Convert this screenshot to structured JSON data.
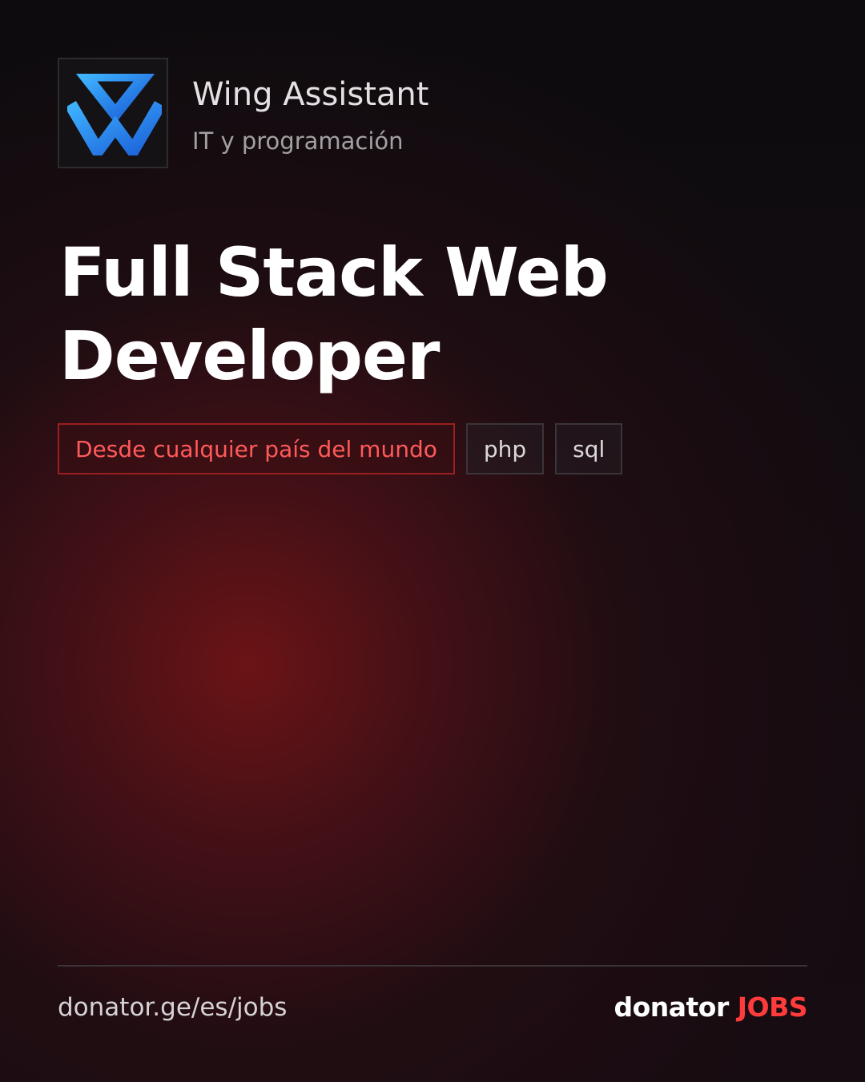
{
  "company": {
    "name": "Wing Assistant",
    "category": "IT y programación",
    "logo_icon": "wing-assistant-logo-icon",
    "logo_color": "#1e8fe8"
  },
  "job": {
    "title": "Full Stack Web Developer"
  },
  "tags": [
    "Desde cualquier país del mundo",
    "php",
    "sql"
  ],
  "footer": {
    "url": "donator.ge/es/jobs",
    "brand_main": "donator",
    "brand_accent": "JOBS"
  },
  "colors": {
    "accent": "#ff3b3b",
    "background": "#0c0a0c",
    "glow": "#701416"
  }
}
